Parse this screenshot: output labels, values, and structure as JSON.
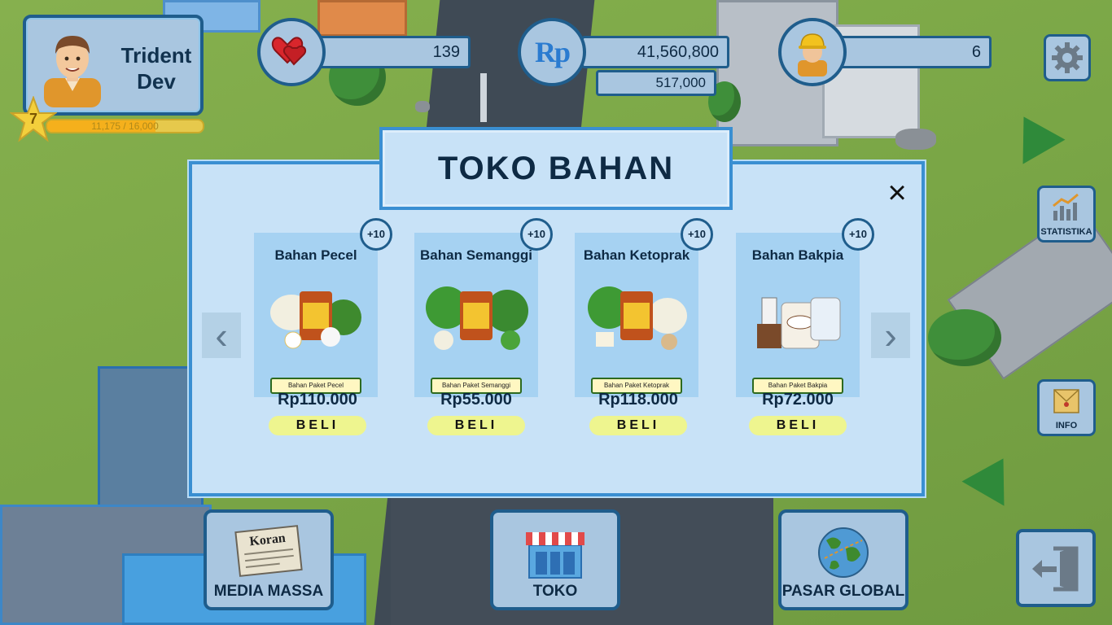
{
  "player": {
    "name_line1": "Trident",
    "name_line2": "Dev",
    "level": "7",
    "xp_text": "11,175 / 16,000",
    "xp_fraction": 0.698
  },
  "stats": {
    "hearts": "139",
    "money": "41,560,800",
    "money_secondary": "517,000",
    "currency_icon": "Rp",
    "workers": "6"
  },
  "side_buttons": {
    "statistika": "STATISTIKA",
    "info": "INFO"
  },
  "modal": {
    "title": "TOKO BAHAN",
    "close": "×",
    "prev": "‹",
    "next": "›",
    "items": [
      {
        "name": "Bahan Pecel",
        "badge": "+10",
        "package_label": "Bahan Paket Pecel",
        "price": "Rp110.000",
        "buy": "BELI"
      },
      {
        "name": "Bahan Semanggi",
        "badge": "+10",
        "package_label": "Bahan Paket Semanggi",
        "price": "Rp55.000",
        "buy": "BELI"
      },
      {
        "name": "Bahan Ketoprak",
        "badge": "+10",
        "package_label": "Bahan Paket Ketoprak",
        "price": "Rp118.000",
        "buy": "BELI"
      },
      {
        "name": "Bahan Bakpia",
        "badge": "+10",
        "package_label": "Bahan Paket Bakpia",
        "price": "Rp72.000",
        "buy": "BELI"
      }
    ]
  },
  "bottom_nav": {
    "media_massa": "MEDIA MASSA",
    "media_icon_text": "Koran",
    "toko": "TOKO",
    "pasar_global": "PASAR GLOBAL"
  },
  "icons": {
    "heart": "heart-icon",
    "currency": "rupiah-icon",
    "worker": "worker-icon",
    "settings": "gear-icon",
    "statistika": "chart-icon",
    "info": "envelope-icon",
    "media": "newspaper-icon",
    "toko": "shop-icon",
    "pasar": "globe-icon",
    "exit": "exit-icon"
  },
  "colors": {
    "panel": "#a9c6e0",
    "panel_border": "#1f5d8c",
    "modal_bg": "#c8e2f7",
    "buy_button": "#eef58f",
    "heart": "#d9262c",
    "xp": "#f5b01c"
  }
}
